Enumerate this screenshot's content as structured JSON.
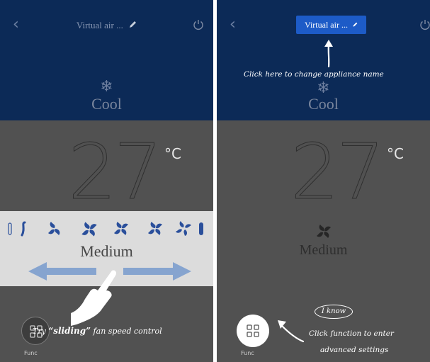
{
  "left_screen": {
    "title": "Virtual air ...",
    "mode": "Cool",
    "temperature": "27",
    "unit": "°C",
    "fan_speed": "Medium",
    "function_label": "Func",
    "hint_prefix": "Try ",
    "hint_emph": "“sliding”",
    "hint_suffix": " fan speed control"
  },
  "right_screen": {
    "appliance_name_button": "Virtual air ...",
    "hint_name": "Click here to change appliance name",
    "mode": "Cool",
    "temperature": "27",
    "unit": "°C",
    "fan_speed": "Medium",
    "i_know": "I know",
    "hint_function_line1": "Click function to enter",
    "hint_function_line2": "advanced settings",
    "function_label": "Func"
  },
  "icons": {
    "back": "chevron-left",
    "power": "power",
    "edit": "pencil",
    "mode": "snowflake",
    "fan": "fan",
    "function": "grid"
  },
  "colors": {
    "header_bg": "#0c2a57",
    "body_bg": "#515151",
    "fan_panel_bg": "#dcdcdc",
    "accent_blue": "#1d5bc7",
    "fan_icon_blue": "#2a4f9b"
  }
}
